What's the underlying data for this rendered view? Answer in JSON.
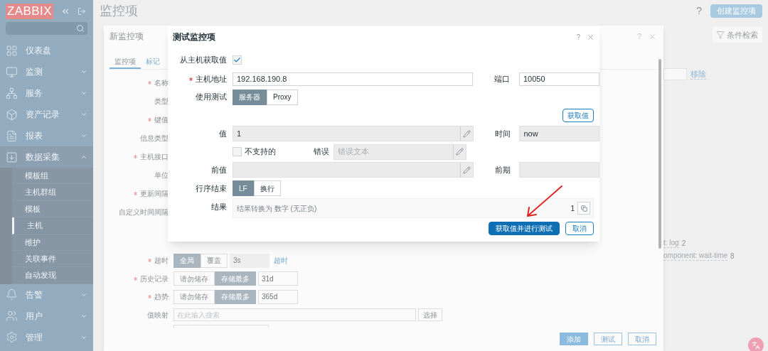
{
  "sidebar": {
    "logo": "ZABBIX",
    "items": [
      {
        "label": "仪表盘"
      },
      {
        "label": "监测",
        "expanded": false
      },
      {
        "label": "服务",
        "expanded": false
      },
      {
        "label": "资产记录",
        "expanded": false
      },
      {
        "label": "报表",
        "expanded": false
      },
      {
        "label": "数据采集",
        "expanded": true,
        "children": [
          {
            "label": "模板组",
            "selected": false
          },
          {
            "label": "主机群组",
            "selected": false
          },
          {
            "label": "模板",
            "selected": false
          },
          {
            "label": "主机",
            "selected": true
          },
          {
            "label": "维护",
            "selected": false
          },
          {
            "label": "关联事件",
            "selected": false
          },
          {
            "label": "自动发现",
            "selected": false
          }
        ]
      },
      {
        "label": "告警",
        "expanded": false
      },
      {
        "label": "用户",
        "expanded": false
      },
      {
        "label": "管理",
        "expanded": false
      }
    ]
  },
  "page": {
    "title": "监控项",
    "help": "?",
    "create_button": "创建监控项",
    "filter_tab": "条件检索",
    "remove_link": "移除",
    "tag_links": [
      {
        "text": "t: log",
        "count": "2"
      },
      {
        "text": "omponent: wait-time",
        "count": "8"
      }
    ]
  },
  "item_dialog": {
    "title": "新监控项",
    "help": "?",
    "tabs": [
      {
        "label": "监控项",
        "selected": true
      },
      {
        "label": "标记",
        "selected": false
      }
    ],
    "fields": [
      {
        "label": "名称",
        "required": true
      },
      {
        "label": "类型",
        "required": false
      },
      {
        "label": "键值",
        "required": true
      },
      {
        "label": "信息类型",
        "required": false
      },
      {
        "label": "主机接口",
        "required": true
      },
      {
        "label": "单位",
        "required": false
      },
      {
        "label": "更新间隔",
        "required": true
      },
      {
        "label": "自定义时间间隔",
        "required": false
      }
    ],
    "lower_fields": [
      {
        "kind": "toggle",
        "label": "超时",
        "required": true,
        "options": [
          {
            "label": "全局",
            "selected": true
          },
          {
            "label": "覆盖",
            "selected": false
          }
        ],
        "value": "3s",
        "disabled": true,
        "link": "超时"
      },
      {
        "kind": "toggle",
        "label": "历史记录",
        "required": true,
        "options": [
          {
            "label": "请勿储存",
            "selected": false
          },
          {
            "label": "存储最多",
            "selected": true
          }
        ],
        "value": "31d",
        "disabled": false
      },
      {
        "kind": "toggle",
        "label": "趋势",
        "required": true,
        "options": [
          {
            "label": "请勿储存",
            "selected": false
          },
          {
            "label": "存储最多",
            "selected": true
          }
        ],
        "value": "365d",
        "disabled": false
      },
      {
        "kind": "search",
        "label": "值映射",
        "required": false,
        "placeholder": "在此输入搜索",
        "button": "选择"
      }
    ],
    "buttons": [
      {
        "label": "添加",
        "primary": true
      },
      {
        "label": "测试",
        "primary": false
      },
      {
        "label": "取消",
        "primary": false
      }
    ]
  },
  "test_dialog": {
    "title": "测试监控项",
    "help": "?",
    "get_from_host": {
      "label": "从主机获取值",
      "checked": true
    },
    "host_address": {
      "label": "主机地址",
      "required": true,
      "value": "192.168.190.8"
    },
    "port": {
      "label": "端口",
      "value": "10050"
    },
    "test_via": {
      "label": "使用测试",
      "options": [
        {
          "label": "服务器",
          "selected": true
        },
        {
          "label": "Proxy",
          "selected": false
        }
      ]
    },
    "get_value_button": "获取值",
    "value": {
      "label": "值",
      "value": "1"
    },
    "time": {
      "label": "时间",
      "value": "now"
    },
    "not_supported": {
      "label": "不支持的",
      "checked": false
    },
    "error": {
      "label": "错误",
      "placeholder": "错误文本"
    },
    "previous_value": {
      "label": "前值"
    },
    "previous_time": {
      "label": "前期"
    },
    "eol": {
      "label": "行序结束",
      "options": [
        {
          "label": "LF",
          "selected": true
        },
        {
          "label": "换行",
          "selected": false
        }
      ]
    },
    "result": {
      "label": "结果",
      "text": "结果转换为 数字 (无正负)",
      "value": "1"
    },
    "buttons": [
      {
        "label": "获取值并进行测试",
        "primary": true
      },
      {
        "label": "取消",
        "primary": false
      }
    ]
  }
}
